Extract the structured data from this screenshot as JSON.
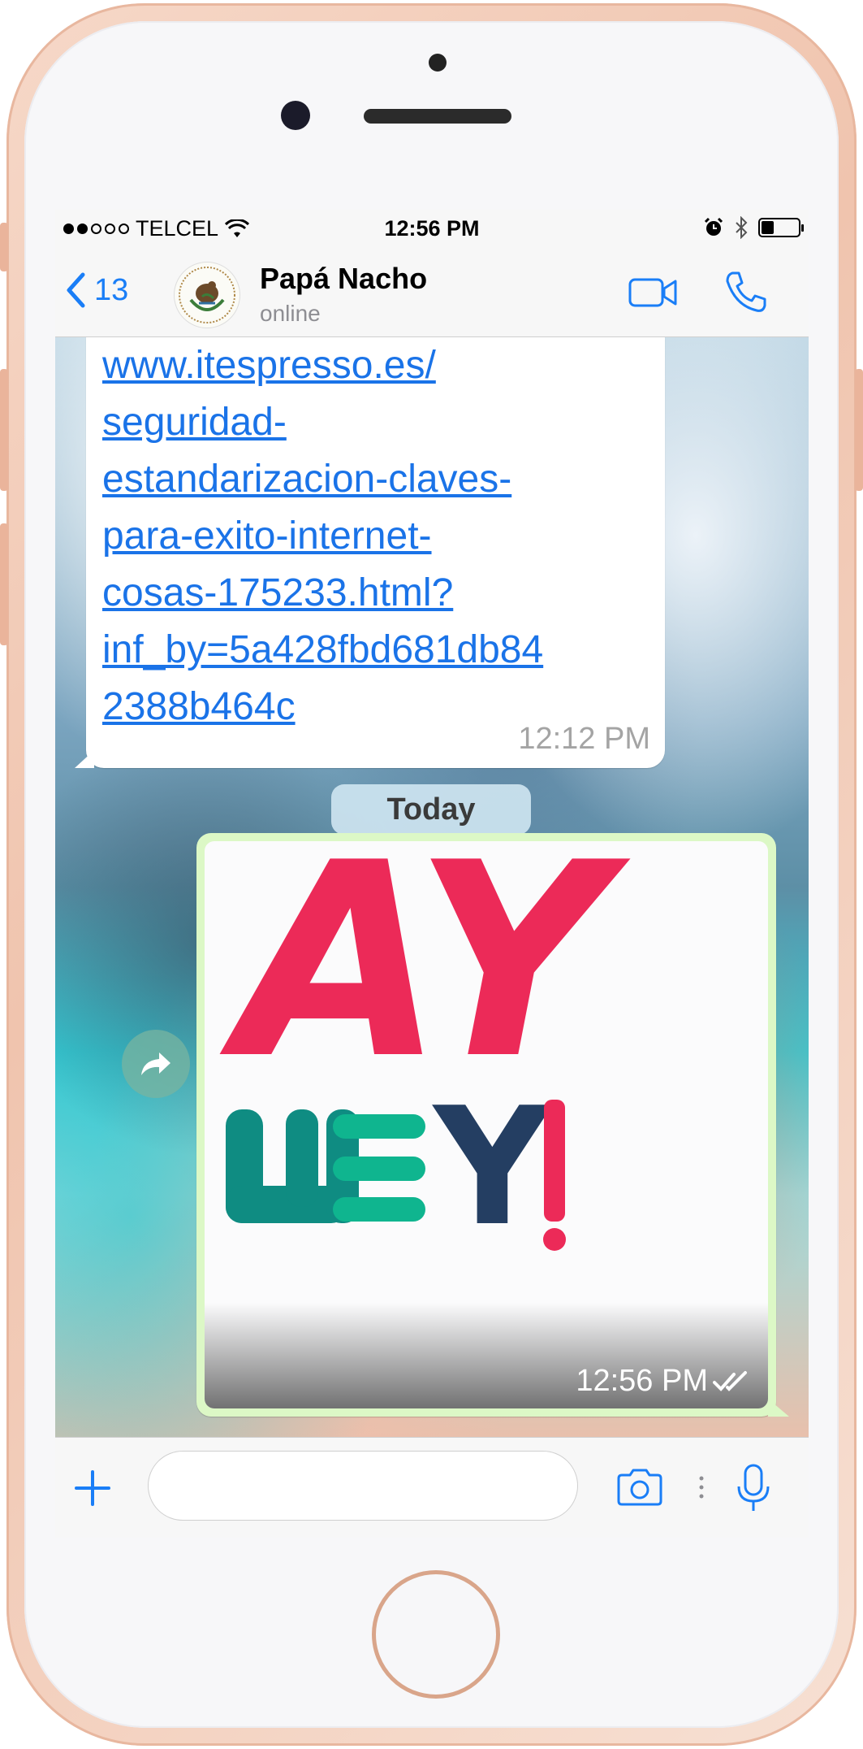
{
  "status_bar": {
    "carrier": "TELCEL",
    "time": "12:56 PM"
  },
  "header": {
    "back_count": "13",
    "contact_name": "Papá Nacho",
    "contact_status": "online"
  },
  "messages": [
    {
      "direction": "incoming",
      "type": "link",
      "lines": [
        "www.itespresso.es/",
        "seguridad-",
        "estandarizacion-claves-",
        "para-exito-internet-",
        "cosas-175233.html?",
        "inf_by=5a428fbd681db84",
        "2388b464c"
      ],
      "time": "12:12 PM"
    },
    {
      "direction": "outgoing",
      "type": "sticker",
      "sticker_line1": "AY",
      "sticker_line2_a": "W",
      "sticker_line2_b": "Y",
      "sticker_line2_c": "!",
      "time": "12:56 PM",
      "read_status": "read"
    }
  ],
  "date_separator": "Today",
  "input": {
    "value": "",
    "placeholder": ""
  },
  "colors": {
    "accent": "#1a7ef7",
    "link": "#1a73e8",
    "outgoing_bubble": "#dcf8c6",
    "sticker_red": "#ec2a58",
    "sticker_green": "#0fb58f",
    "sticker_navy": "#243e62"
  },
  "icons": {
    "back": "chevron-left-icon",
    "video": "video-camera-icon",
    "call": "phone-icon",
    "add": "plus-icon",
    "camera": "camera-icon",
    "mic": "microphone-icon",
    "forward": "forward-icon"
  }
}
